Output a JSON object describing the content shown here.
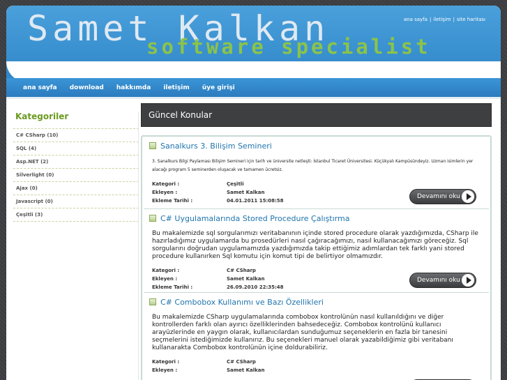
{
  "brand": {
    "name": "Samet Kalkan",
    "tagline": "software specialist"
  },
  "toplinks": [
    "ana sayfa",
    "iletişim",
    "site haritası"
  ],
  "nav": [
    "ana sayfa",
    "download",
    "hakkımda",
    "iletişim",
    "üye girişi"
  ],
  "sidebar": {
    "title": "Kategoriler",
    "items": [
      {
        "label": "C# CSharp (10)"
      },
      {
        "label": "SQL (4)"
      },
      {
        "label": "Asp.NET (2)"
      },
      {
        "label": "Silverlight (0)"
      },
      {
        "label": "Ajax (0)"
      },
      {
        "label": "Javascript (0)"
      },
      {
        "label": "Çeşitli (3)"
      }
    ]
  },
  "main": {
    "title": "Güncel Konular",
    "meta_labels": {
      "category": "Kategori :",
      "author": "Ekleyen :",
      "date": "Ekleme Tarihi :"
    },
    "more_label": "Devamını oku",
    "posts": [
      {
        "title": "Sanalkurs 3. Bilişim Semineri",
        "body": "3. Sanalkurs Bilgi Paylaması Bilişim Semineri için tarih ve üniversite netleşti: İstanbul Ticaret Üniversitesi. Küçükyalı Kampüsündeyiz. Uzman isimlerin yer alacağı program 5 seminerden oluşacak ve tamamen ücretsiz.",
        "category": "Çeşitli",
        "author": "Samet Kalkan",
        "date": "04.01.2011 15:08:58"
      },
      {
        "title": "C# Uygulamalarında Stored Procedure Çalıştırma",
        "body": "Bu makalemizde sql sorgularımızı veritabanının içinde stored procedure olarak yazdığımızda, CSharp ile hazırladığımız uygulamarda bu prosedürleri nasıl çağıracağımızı, nasıl kullanacağımızı göreceğiz. Sql sorgularını doğrudan uygulamamızda yazdığımızda takip ettiğimiz adımlardan tek farklı yani stored procedure kullanırken Sql komutu için komut tipi de belirtiyor olmamızdır.",
        "category": "C# CSharp",
        "author": "Samet Kalkan",
        "date": "26.09.2010 22:35:48"
      },
      {
        "title": "C# Combobox Kullanımı ve Bazı Özellikleri",
        "body": "Bu makalemizde CSharp uygulamalarında combobox kontrolünün nasıl kullanıldığını ve diğer kontrollerden farklı olan ayırıcı özelliklerinden bahsedeceğiz. Combobox kontrolünü kullanıcı arayüzlerinde en yaygın olarak, kullanıcılardan sunduğumuz seçeneklerin en fazla bir tanesini seçmelerini istediğimizde kullanırız. Bu seçenekleri manuel olarak yazabildiğimiz gibi veritabanı kullanarakta Combobox kontrolünün içine doldurabiliriz.",
        "category": "C# CSharp",
        "author": "Samet Kalkan",
        "date": ""
      }
    ]
  }
}
